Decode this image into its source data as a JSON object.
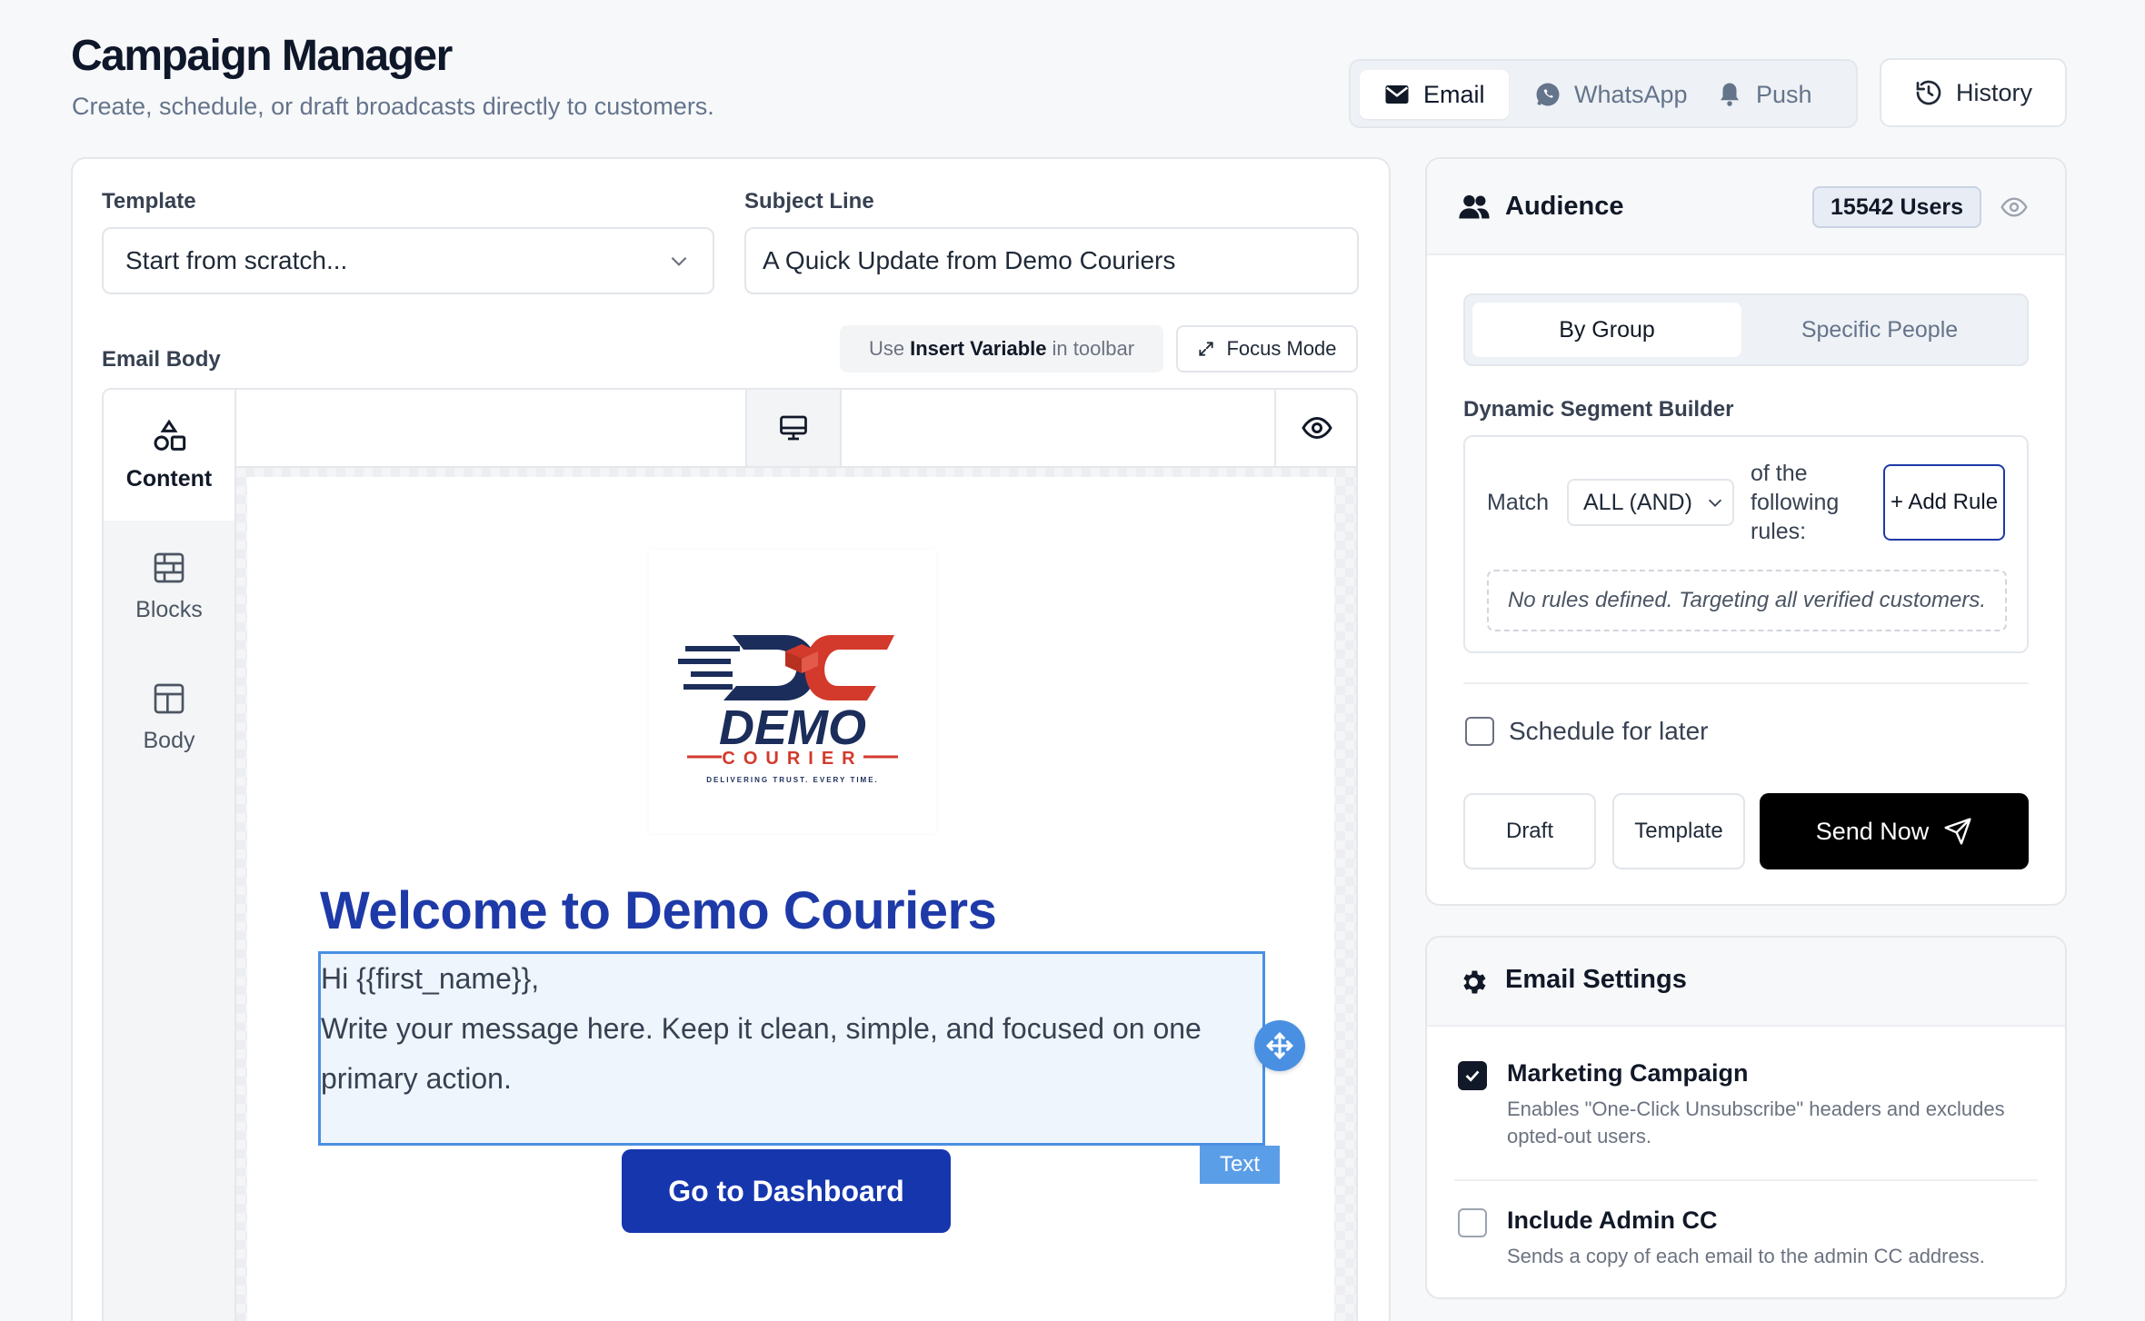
{
  "header": {
    "title": "Campaign Manager",
    "subtitle": "Create, schedule, or draft broadcasts directly to customers."
  },
  "channels": [
    {
      "label": "Email",
      "icon": "mail-icon",
      "active": true
    },
    {
      "label": "WhatsApp",
      "icon": "whatsapp-icon",
      "active": false
    },
    {
      "label": "Push",
      "icon": "bell-icon",
      "active": false
    }
  ],
  "history_label": "History",
  "form": {
    "template_label": "Template",
    "template_value": "Start from scratch...",
    "subject_label": "Subject Line",
    "subject_value": "A Quick Update from Demo Couriers",
    "body_label": "Email Body",
    "hint_prefix": "Use",
    "hint_bold": "Insert Variable",
    "hint_suffix": "in toolbar",
    "focus_label": "Focus Mode"
  },
  "editor": {
    "side_items": [
      {
        "label": "Content",
        "icon": "shapes-icon"
      },
      {
        "label": "Blocks",
        "icon": "blocks-icon"
      },
      {
        "label": "Body",
        "icon": "layout-icon"
      }
    ],
    "email": {
      "logo_main": "DEMO",
      "logo_sub": "COURIER",
      "logo_tag": "DELIVERING TRUST. EVERY TIME.",
      "heading": "Welcome to Demo Couriers",
      "greeting": "Hi {{first_name}},",
      "body": "Write your message here. Keep it clean, simple, and focused on one primary action.",
      "cta": "Go to Dashboard",
      "selected_tag": "Text"
    }
  },
  "audience": {
    "title": "Audience",
    "users_badge": "15542 Users",
    "tabs": [
      "By Group",
      "Specific People"
    ],
    "segment_label": "Dynamic Segment Builder",
    "match_label": "Match",
    "match_value": "ALL (AND)",
    "rules_suffix": "of the following rules:",
    "add_rule": "+ Add Rule",
    "no_rules": "No rules defined. Targeting all verified customers.",
    "schedule_label": "Schedule for later",
    "draft_label": "Draft",
    "template_btn_label": "Template",
    "send_label": "Send Now"
  },
  "settings": {
    "title": "Email Settings",
    "options": [
      {
        "title": "Marketing Campaign",
        "desc": "Enables \"One-Click Unsubscribe\" headers and excludes opted-out users.",
        "checked": true
      },
      {
        "title": "Include Admin CC",
        "desc": "Sends a copy of each email to the admin CC address.",
        "checked": false
      }
    ]
  },
  "colors": {
    "brand_blue": "#1e3aa8",
    "cta_blue": "#1636ae",
    "logo_red": "#d33a2c",
    "selection_blue": "#4a90e2"
  }
}
